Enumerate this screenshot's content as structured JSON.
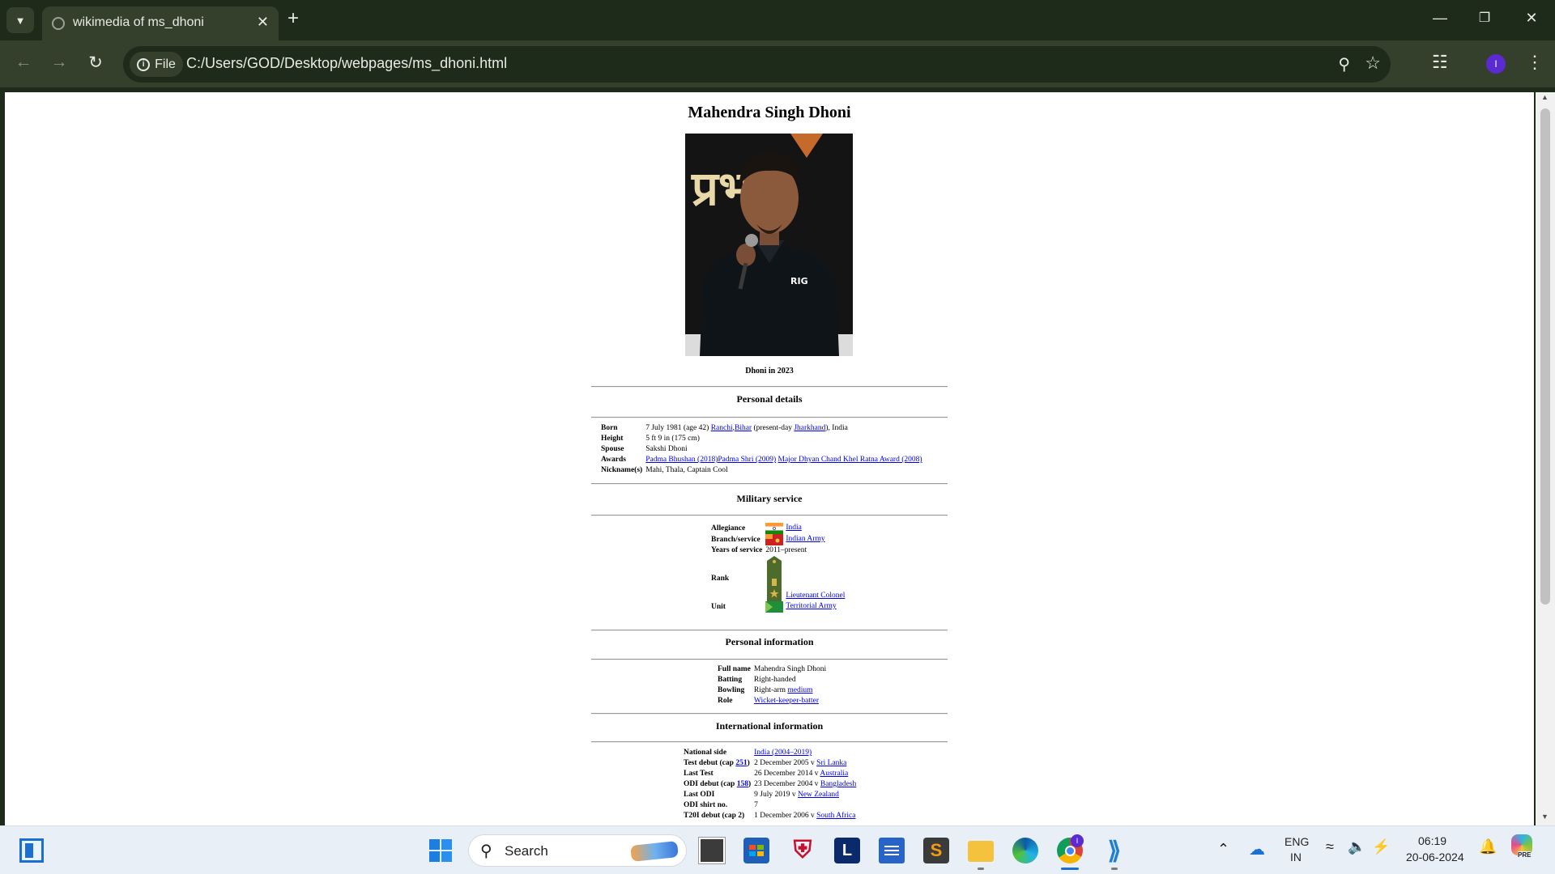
{
  "browser": {
    "tab_title": "wikimedia of ms_dhoni",
    "file_chip": "File",
    "url": "C:/Users/GOD/Desktop/webpages/ms_dhoni.html",
    "profile_initial": "I"
  },
  "article": {
    "title": "Mahendra Singh Dhoni",
    "image_caption": "Dhoni in 2023",
    "portrait_backdrop_text": "प्रभा",
    "shirt_text": "RIG",
    "personal_details": {
      "heading": "Personal details",
      "born_label": "Born",
      "born_prefix": "7 July 1981 (age 42) ",
      "born_link1": "Ranchi",
      "born_link2": "Bihar",
      "born_mid": " (present-day ",
      "born_link3": "Jharkhand",
      "born_suffix": "), India",
      "height_label": "Height",
      "height_value": "5 ft 9 in (175 cm)",
      "spouse_label": "Spouse",
      "spouse_value": "Sakshi Dhoni",
      "awards_label": "Awards",
      "award1": "Padma Bhushan (2018)",
      "award2": "Padma Shri (2009)",
      "award3": "Major Dhyan Chand Khel Ratna Award (2008)",
      "nickname_label": "Nickname(s)",
      "nickname_value": "Mahi, Thala, Captain Cool"
    },
    "military": {
      "heading": "Military service",
      "allegiance_label": "Allegiance",
      "allegiance_value": "India",
      "branch_label": "Branch/service",
      "branch_value": "Indian Army",
      "years_label": "Years of service",
      "years_value": "2011–present",
      "rank_label": "Rank",
      "rank_value": "Lieutenant Colonel",
      "unit_label": "Unit",
      "unit_value": "Territorial Army"
    },
    "personal_info": {
      "heading": "Personal information",
      "fullname_label": "Full name",
      "fullname_value": "Mahendra Singh Dhoni",
      "batting_label": "Batting",
      "batting_value": "Right-handed",
      "bowling_label": "Bowling",
      "bowling_prefix": "Right-arm ",
      "bowling_link": "medium",
      "role_label": "Role",
      "role_value": "Wicket-keeper-batter"
    },
    "international": {
      "heading": "International information",
      "national_label": "National side",
      "national_value": "India (2004–2019)",
      "test_debut_label_pre": "Test debut (cap ",
      "test_cap": "251",
      "label_close": ")",
      "test_debut_value": "2 December 2005 v ",
      "test_debut_opp": "Sri Lanka",
      "last_test_label": "Last Test",
      "last_test_value": "26 December 2014 v ",
      "last_test_opp": "Australia",
      "odi_debut_label_pre": "ODI debut (cap ",
      "odi_cap": "158",
      "odi_debut_value": "23 December 2004 v ",
      "odi_debut_opp": "Bangladesh",
      "last_odi_label": "Last ODI",
      "last_odi_value": "9 July 2019 v ",
      "last_odi_opp": "New Zealand",
      "odi_shirt_label": "ODI shirt no.",
      "odi_shirt_value": "7",
      "t20i_debut_label": "T20I debut (cap 2)",
      "t20i_debut_value": "1 December 2006 v ",
      "t20i_debut_opp": "South Africa"
    }
  },
  "taskbar": {
    "search_label": "Search",
    "lang_line1": "ENG",
    "lang_line2": "IN",
    "time": "06:19",
    "date": "20-06-2024",
    "chrome_badge": "I",
    "copilot_badge": "PRE",
    "launcher_letter": "L"
  }
}
